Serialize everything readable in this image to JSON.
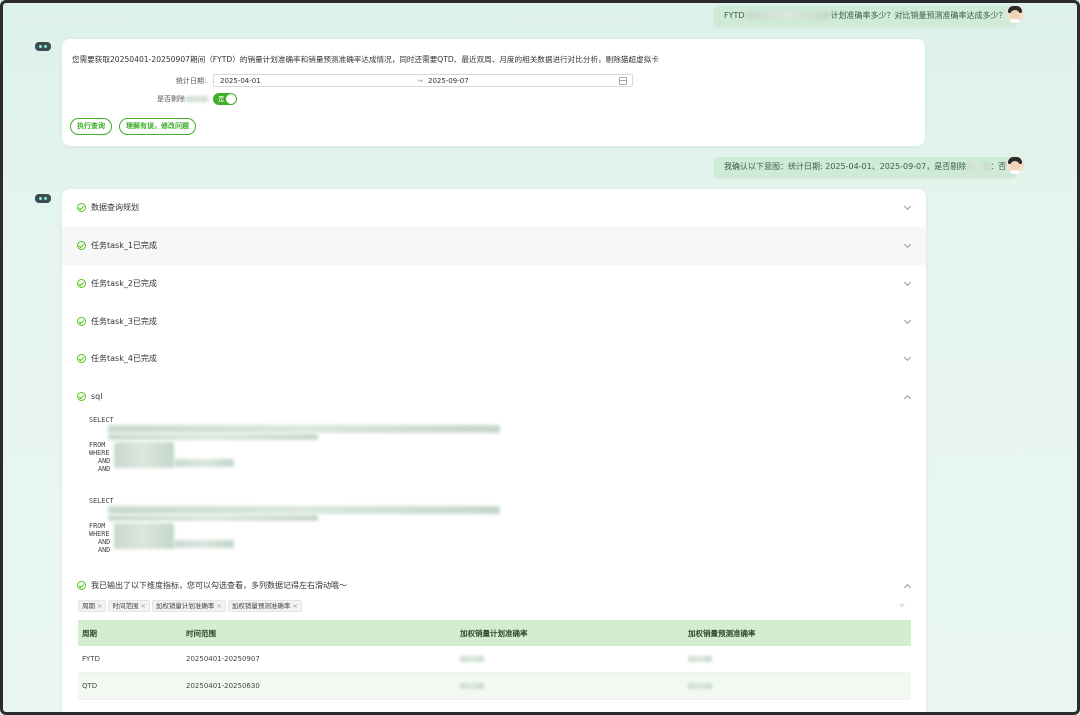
{
  "messages": {
    "user_q1": {
      "prefix": "FYTD",
      "suffix": "计划准确率多少？对比销量预测准确率达成多少？"
    },
    "bot_reply1": {
      "intro": "您需要获取20250401-20250907期间（FYTD）的销量计划准确率和销量预测准确率达成情况，同时还需要QTD、最近双周、月度的相关数据进行对比分析，剔除猫超虚拟卡",
      "date_label": "统计日期:",
      "date_start": "2025-04-01",
      "date_sep": "→",
      "date_end": "2025-09-07",
      "toggle_label_prefix": "是否剔除",
      "toggle_value": "是",
      "btn_execute": "执行查询",
      "btn_modify": "理解有误，修改问题"
    },
    "user_q2": {
      "prefix": "我确认以下意图：统计日期: 2025-04-01、2025-09-07，是否剔除",
      "suffix": "：否"
    }
  },
  "sections": [
    {
      "label": "数据查询规划",
      "expanded": false
    },
    {
      "label": "任务task_1已完成",
      "expanded": false
    },
    {
      "label": "任务task_2已完成",
      "expanded": false
    },
    {
      "label": "任务task_3已完成",
      "expanded": false
    },
    {
      "label": "任务task_4已完成",
      "expanded": false
    },
    {
      "label": "sql",
      "expanded": true
    },
    {
      "label": "我已输出了以下维度指标，您可以勾选查看，多列数据记得左右滑动哦～",
      "expanded": true
    }
  ],
  "sql": {
    "kw_select": "SELECT",
    "kw_from": "FROM",
    "kw_where": "WHERE",
    "kw_and": "AND"
  },
  "tags": [
    "周期",
    "时间范围",
    "加权销量计划准确率",
    "加权销量预测准确率"
  ],
  "tag_close": "×",
  "table": {
    "headers": [
      "周期",
      "时间范围",
      "加权销量计划准确率",
      "加权销量预测准确率"
    ],
    "rows": [
      [
        "FYTD",
        "20250401-20250907",
        "",
        ""
      ],
      [
        "QTD",
        "20250401-20250630",
        "",
        ""
      ]
    ]
  },
  "colors": {
    "accent": "#3fae2a",
    "user_bubble": "#cfead6",
    "table_header": "#d3edcf"
  }
}
